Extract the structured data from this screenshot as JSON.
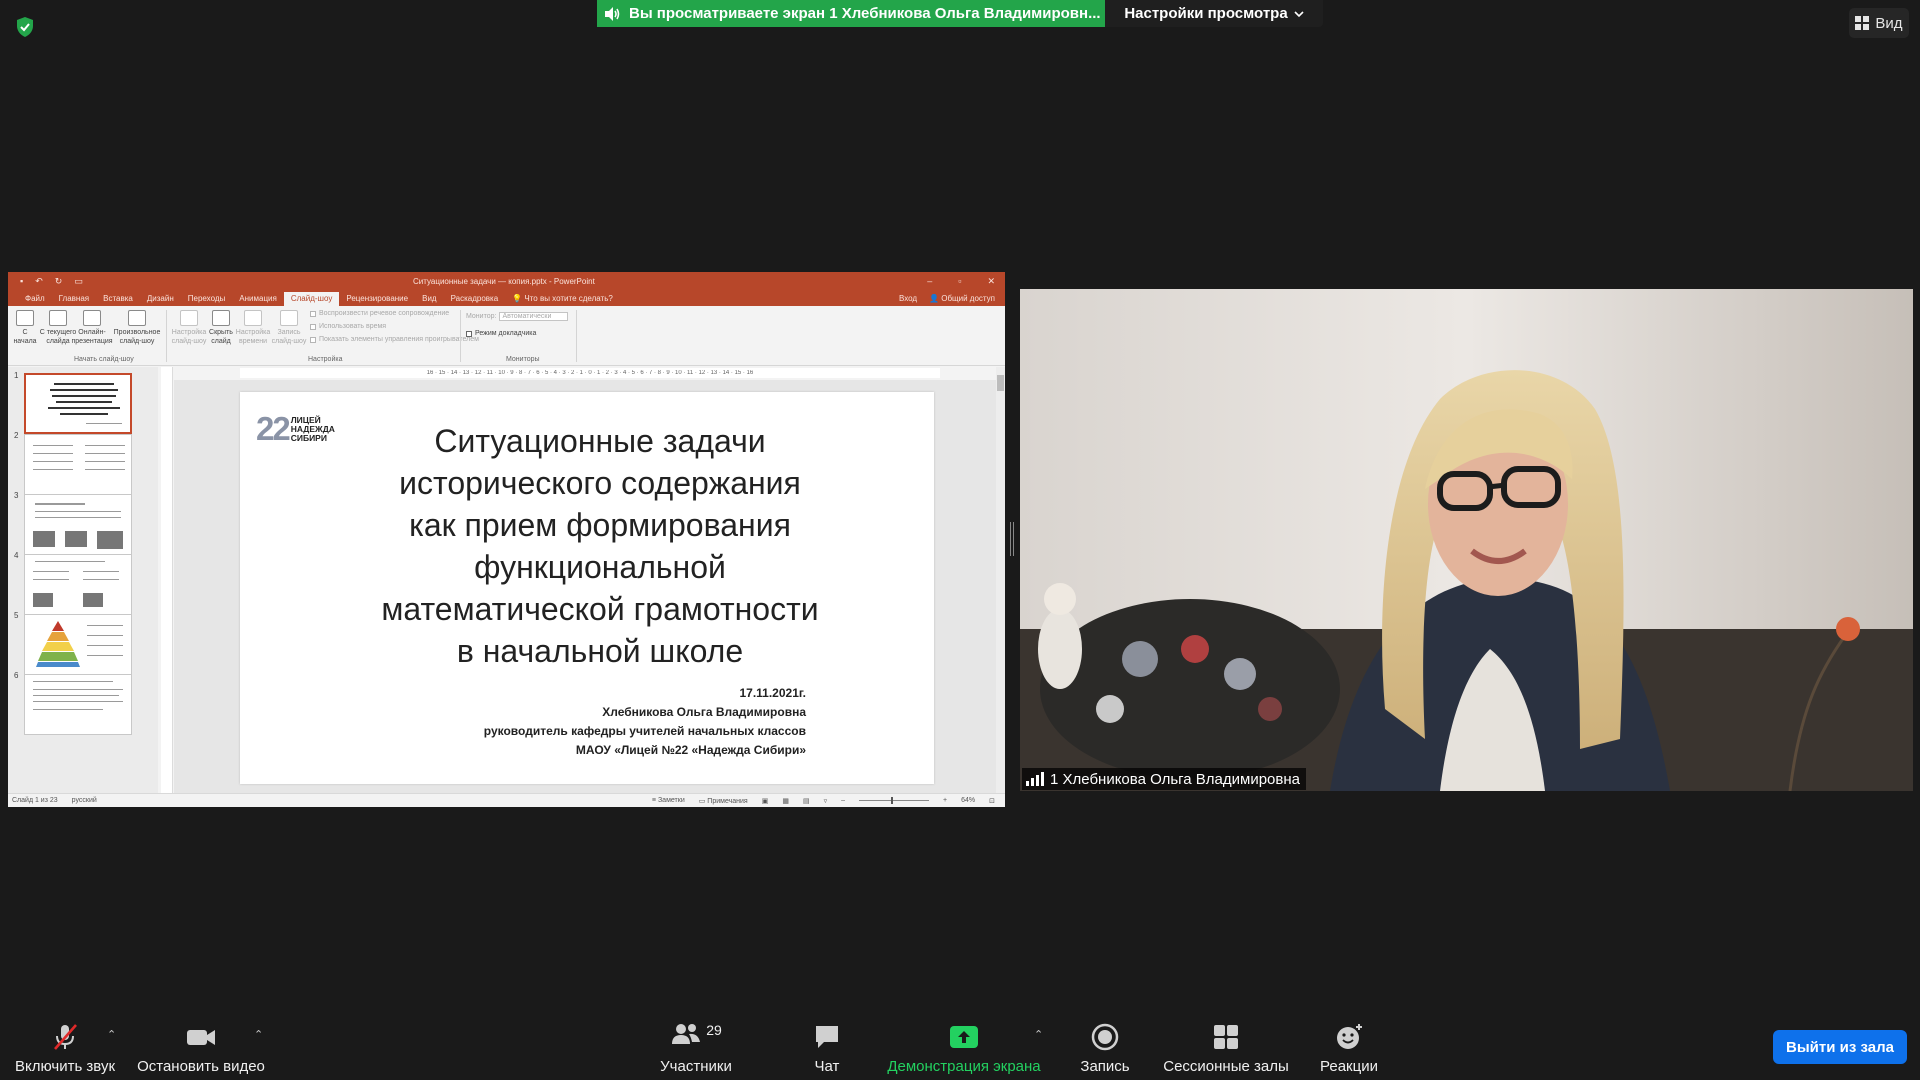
{
  "top": {
    "share_banner": "Вы просматриваете экран 1 Хлебникова Ольга Владимировн...",
    "view_settings": "Настройки просмотра",
    "view_label": "Вид"
  },
  "ppt": {
    "window_title": "Ситуационные задачи — копия.pptx - PowerPoint",
    "tabs": [
      "Файл",
      "Главная",
      "Вставка",
      "Дизайн",
      "Переходы",
      "Анимация",
      "Слайд-шоу",
      "Рецензирование",
      "Вид",
      "Раскадровка"
    ],
    "tell_me": "Что вы хотите сделать?",
    "sign_in": "Вход",
    "share": "Общий доступ",
    "ribbon": {
      "from_start": "С начала",
      "from_current": "С текущего слайда",
      "online": "Онлайн-презентация",
      "custom": "Произвольное слайд-шоу",
      "group_start": "Начать слайд-шоу",
      "setup": "Настройка слайд-шоу",
      "hide": "Скрыть слайд",
      "timing": "Настройка времени",
      "record": "Запись слайд-шоу",
      "check_narration": "Воспроизвести речевое сопровождение",
      "check_timing": "Использовать время",
      "check_controls": "Показать элементы управления проигрывателем",
      "group_setup": "Настройка",
      "monitor_label": "Монитор:",
      "monitor_value": "Автоматически",
      "presenter": "Режим докладчика",
      "group_monitors": "Мониторы"
    },
    "ruler": "16 · 15 · 14 · 13 · 12 · 11 · 10 · 9 · 8 · 7 · 6 · 5 · 4 · 3 · 2 · 1 · 0 · 1 · 2 · 3 · 4 · 5 · 6 · 7 · 8 · 9 · 10 · 11 · 12 · 13 · 14 · 15 · 16",
    "thumb_numbers": [
      "1",
      "2",
      "3",
      "4",
      "5",
      "6"
    ],
    "slide": {
      "logo_number": "22",
      "logo_line1": "ЛИЦЕЙ",
      "logo_line2": "НАДЕЖДА",
      "logo_line3": "СИБИРИ",
      "title_lines": [
        "Ситуационные задачи",
        "исторического содержания",
        "как прием формирования",
        "функциональной",
        "математической грамотности",
        "в начальной школе"
      ],
      "date": "17.11.2021г.",
      "author": "Хлебникова Ольга Владимировна",
      "role": "руководитель кафедры учителей начальных классов",
      "school": "МАОУ «Лицей №22 «Надежда Сибири»"
    },
    "status": {
      "slide_of": "Слайд 1 из 23",
      "language": "русский",
      "notes": "Заметки",
      "comments": "Примечания",
      "zoom": "64%"
    }
  },
  "camera": {
    "name": "1 Хлебникова Ольга Владимировна"
  },
  "toolbar": {
    "mute": "Включить звук",
    "video": "Остановить видео",
    "participants": "Участники",
    "participants_count": "29",
    "chat": "Чат",
    "share": "Демонстрация экрана",
    "record": "Запись",
    "breakout": "Сессионные залы",
    "reactions": "Реакции",
    "leave": "Выйти из зала"
  },
  "colors": {
    "banner_green": "#23a54a",
    "ppt_red": "#b7472a",
    "leave_blue": "#0e71eb",
    "share_green": "#23d160"
  }
}
